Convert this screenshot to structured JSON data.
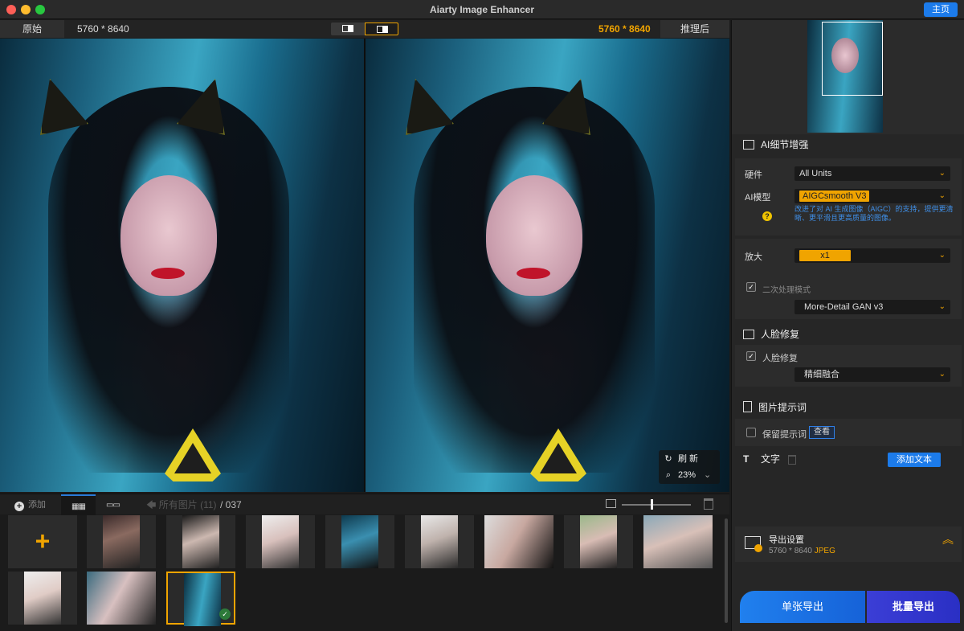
{
  "window": {
    "title": "Aiarty Image Enhancer",
    "home_label": "主页"
  },
  "preview": {
    "left_label": "原始",
    "left_size": "5760 * 8640",
    "right_size": "5760 * 8640",
    "right_label": "推理后",
    "refresh_label": "刷  新",
    "zoom": "23%"
  },
  "thumbs_toolbar": {
    "add_label": "添加",
    "all_images": "所有图片 (11)",
    "count": "/ 037"
  },
  "thumbnails": {
    "add_plus": "+",
    "selected_check": "✓"
  },
  "panel": {
    "ai_detail_title": "AI细节增强",
    "hardware_label": "硬件",
    "hardware_value": "All Units",
    "model_label": "AI模型",
    "model_value": "AIGCsmooth  V3",
    "model_desc": "改进了对 AI 生成图像（AIGC）的支持，提供更清晰、更平滑且更高质量的图像。",
    "help_glyph": "?",
    "upscale_label": "放大",
    "upscale_value": "x1",
    "secondary_label": "二次处理模式",
    "secondary_value": "More-Detail GAN v3",
    "face_title": "人脸修复",
    "face_check_label": "人脸修复",
    "face_value": "精细融合",
    "prompt_title": "图片提示词",
    "keep_prompt_label": "保留提示词",
    "view_label": "查看",
    "text_title": "文字",
    "add_text_label": "添加文本",
    "export_title": "导出设置",
    "export_size": "5760 * 8640",
    "export_format": "JPEG",
    "single_export": "单张导出",
    "batch_export": "批量导出"
  },
  "colors": {
    "accent": "#f0a400",
    "primary_blue": "#1c7bea",
    "batch_blue": "#3b3ed6"
  }
}
